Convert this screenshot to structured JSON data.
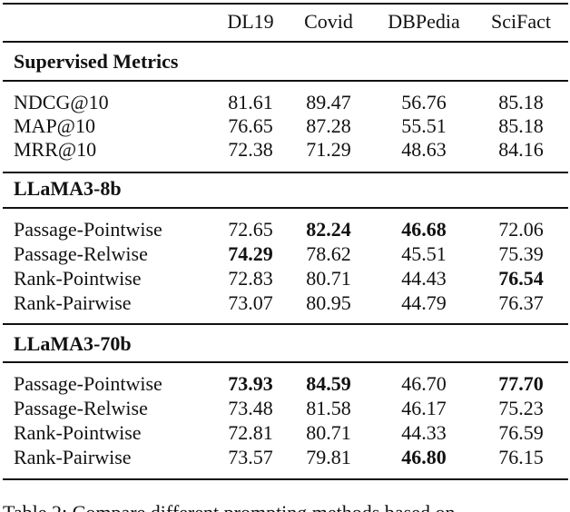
{
  "table": {
    "columns": [
      "DL19",
      "Covid",
      "DBPedia",
      "SciFact"
    ],
    "sections": [
      {
        "title": "Supervised Metrics",
        "rows": [
          {
            "label": "NDCG@10",
            "values": [
              "81.61",
              "89.47",
              "56.76",
              "85.18"
            ],
            "bold": [
              false,
              false,
              false,
              false
            ]
          },
          {
            "label": "MAP@10",
            "values": [
              "76.65",
              "87.28",
              "55.51",
              "85.18"
            ],
            "bold": [
              false,
              false,
              false,
              false
            ]
          },
          {
            "label": "MRR@10",
            "values": [
              "72.38",
              "71.29",
              "48.63",
              "84.16"
            ],
            "bold": [
              false,
              false,
              false,
              false
            ]
          }
        ]
      },
      {
        "title": "LLaMA3-8b",
        "rows": [
          {
            "label": "Passage-Pointwise",
            "values": [
              "72.65",
              "82.24",
              "46.68",
              "72.06"
            ],
            "bold": [
              false,
              true,
              true,
              false
            ]
          },
          {
            "label": "Passage-Relwise",
            "values": [
              "74.29",
              "78.62",
              "45.51",
              "75.39"
            ],
            "bold": [
              true,
              false,
              false,
              false
            ]
          },
          {
            "label": "Rank-Pointwise",
            "values": [
              "72.83",
              "80.71",
              "44.43",
              "76.54"
            ],
            "bold": [
              false,
              false,
              false,
              true
            ]
          },
          {
            "label": "Rank-Pairwise",
            "values": [
              "73.07",
              "80.95",
              "44.79",
              "76.37"
            ],
            "bold": [
              false,
              false,
              false,
              false
            ]
          }
        ]
      },
      {
        "title": "LLaMA3-70b",
        "rows": [
          {
            "label": "Passage-Pointwise",
            "values": [
              "73.93",
              "84.59",
              "46.70",
              "77.70"
            ],
            "bold": [
              true,
              true,
              false,
              true
            ]
          },
          {
            "label": "Passage-Relwise",
            "values": [
              "73.48",
              "81.58",
              "46.17",
              "75.23"
            ],
            "bold": [
              false,
              false,
              false,
              false
            ]
          },
          {
            "label": "Rank-Pointwise",
            "values": [
              "72.81",
              "80.71",
              "44.33",
              "76.59"
            ],
            "bold": [
              false,
              false,
              false,
              false
            ]
          },
          {
            "label": "Rank-Pairwise",
            "values": [
              "73.57",
              "79.81",
              "46.80",
              "76.15"
            ],
            "bold": [
              false,
              false,
              true,
              false
            ]
          }
        ]
      }
    ]
  },
  "caption": "Table 2: Compare different prompting methods based on"
}
